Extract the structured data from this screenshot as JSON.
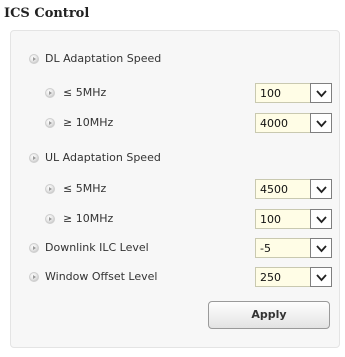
{
  "title": "ICS Control",
  "sections": [
    {
      "label": "DL Adaptation Speed",
      "items": [
        {
          "label": "≤ 5MHz",
          "value": "100"
        },
        {
          "label": "≥ 10MHz",
          "value": "4000"
        }
      ]
    },
    {
      "label": "UL Adaptation Speed",
      "items": [
        {
          "label": "≤ 5MHz",
          "value": "4500"
        },
        {
          "label": "≥ 10MHz",
          "value": "100"
        }
      ]
    }
  ],
  "settings": [
    {
      "label": "Downlink ILC Level",
      "value": "-5"
    },
    {
      "label": "Window Offset Level",
      "value": "250"
    }
  ],
  "apply_label": "Apply"
}
